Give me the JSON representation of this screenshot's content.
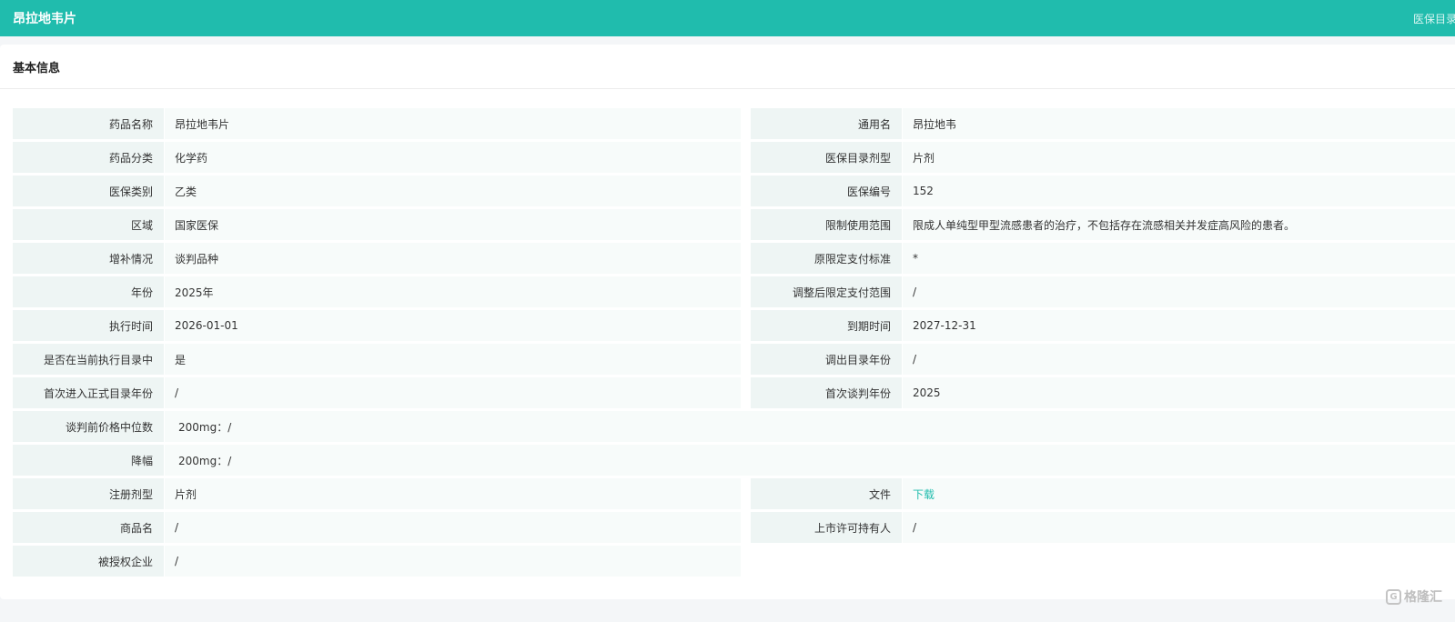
{
  "header": {
    "title": "昂拉地韦片",
    "right_link": "医保目录"
  },
  "section": {
    "title": "基本信息"
  },
  "rows": [
    {
      "left_label": "药品名称",
      "left_value": "昂拉地韦片",
      "right_label": "通用名",
      "right_value": "昂拉地韦"
    },
    {
      "left_label": "药品分类",
      "left_value": "化学药",
      "right_label": "医保目录剂型",
      "right_value": "片剂"
    },
    {
      "left_label": "医保类别",
      "left_value": "乙类",
      "right_label": "医保编号",
      "right_value": "152"
    },
    {
      "left_label": "区域",
      "left_value": "国家医保",
      "right_label": "限制使用范围",
      "right_value": "限成人单纯型甲型流感患者的治疗，不包括存在流感相关并发症高风险的患者。"
    },
    {
      "left_label": "增补情况",
      "left_value": "谈判品种",
      "right_label": "原限定支付标准",
      "right_value": "*"
    },
    {
      "left_label": "年份",
      "left_value": "2025年",
      "right_label": "调整后限定支付范围",
      "right_value": "/"
    },
    {
      "left_label": "执行时间",
      "left_value": "2026-01-01",
      "right_label": "到期时间",
      "right_value": "2027-12-31"
    },
    {
      "left_label": "是否在当前执行目录中",
      "left_value": "是",
      "right_label": "调出目录年份",
      "right_value": "/"
    },
    {
      "left_label": "首次进入正式目录年份",
      "left_value": "/",
      "right_label": "首次谈判年份",
      "right_value": "2025"
    },
    {
      "full_label": "谈判前价格中位数",
      "full_value": "200mg：/"
    },
    {
      "full_label": "降幅",
      "full_value": "200mg：/"
    },
    {
      "left_label": "注册剂型",
      "left_value": "片剂",
      "right_label": "文件",
      "right_value": "下载"
    },
    {
      "left_label": "商品名",
      "left_value": "/",
      "right_label": "上市许可持有人",
      "right_value": "/"
    },
    {
      "left_label": "被授权企业",
      "left_value": "/"
    }
  ],
  "watermark": {
    "text": "格隆汇"
  }
}
